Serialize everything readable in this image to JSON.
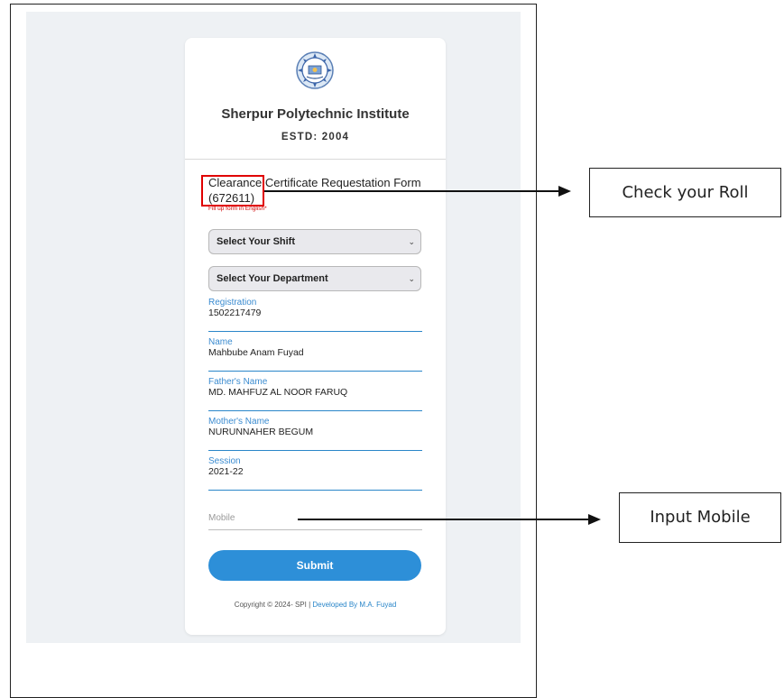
{
  "institute": {
    "name": "Sherpur Polytechnic Institute",
    "established": "ESTD: 2004"
  },
  "form": {
    "title_line1": "Clearance Certificate Requestation Form",
    "roll": "(672611)",
    "note": "Fill up form in English*",
    "shift_select": "Select Your Shift",
    "department_select": "Select Your Department",
    "fields": [
      {
        "label": "Registration",
        "value": "1502217479"
      },
      {
        "label": "Name",
        "value": "Mahbube Anam Fuyad"
      },
      {
        "label": "Father's Name",
        "value": "MD. MAHFUZ AL NOOR FARUQ"
      },
      {
        "label": "Mother's Name",
        "value": "NURUNNAHER BEGUM"
      },
      {
        "label": "Session",
        "value": "2021-22"
      }
    ],
    "mobile_placeholder": "Mobile",
    "submit_label": "Submit"
  },
  "footer": {
    "copyright": "Copyright © 2024- SPI | ",
    "developer": "Developed By M.A. Fuyad"
  },
  "annotations": {
    "roll_callout": "Check your Roll",
    "mobile_callout": "Input Mobile"
  },
  "colors": {
    "accent": "#2d8fd8",
    "highlight": "#e00000",
    "page_background": "#eef1f4"
  }
}
